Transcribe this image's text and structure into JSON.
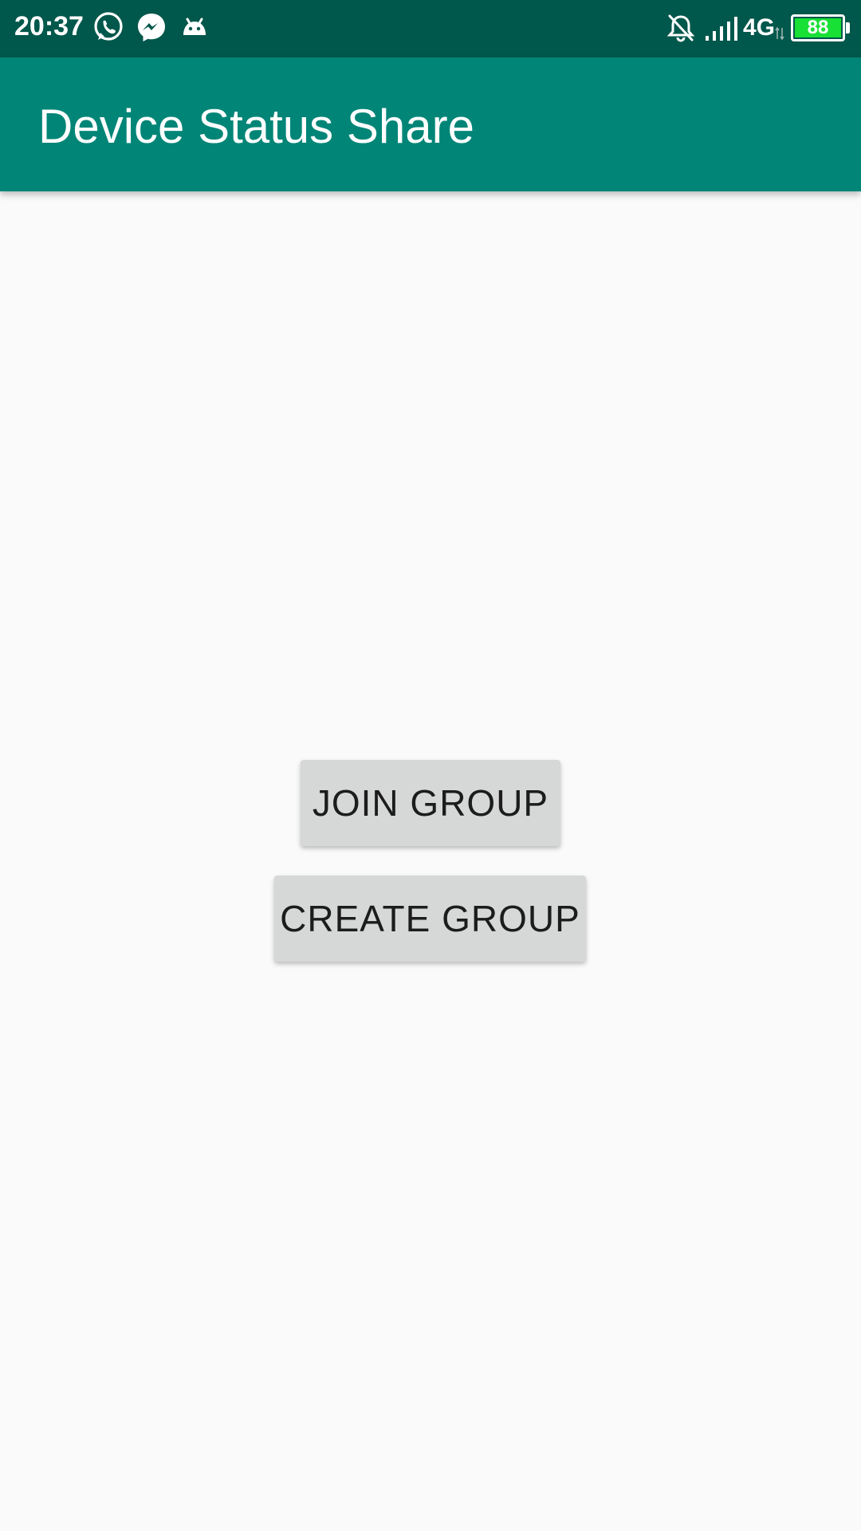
{
  "status_bar": {
    "time": "20:37",
    "notification_icons": [
      "whatsapp-icon",
      "messenger-icon",
      "android-debug-icon"
    ],
    "status_icons": [
      "bell-off-icon",
      "signal-icon"
    ],
    "network": "4G",
    "battery_level": "88",
    "background_color": "#00574b"
  },
  "app_bar": {
    "title": "Device Status Share",
    "background_color": "#008577"
  },
  "main": {
    "join_button_label": "JOIN GROUP",
    "create_button_label": "CREATE GROUP"
  }
}
